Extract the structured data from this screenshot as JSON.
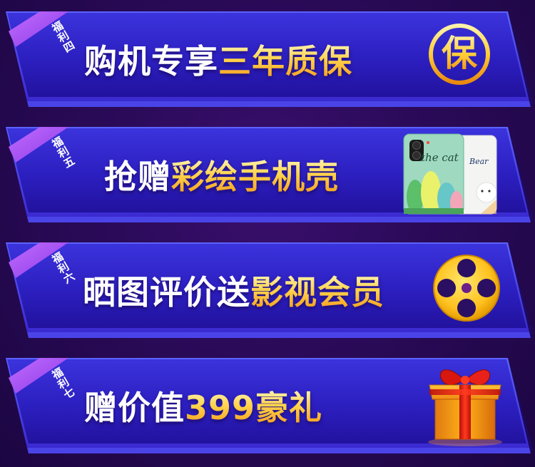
{
  "banners": [
    {
      "tag": "福利四",
      "headline_white": "购机专享",
      "headline_gold": "三年质保",
      "badge_char": "保",
      "icon": "warranty-badge-icon"
    },
    {
      "tag": "福利五",
      "headline_white": "抢赠",
      "headline_gold": "彩绘手机壳",
      "case_left_text": "the cat",
      "case_right_text": "Bear",
      "icon": "phone-case-image"
    },
    {
      "tag": "福利六",
      "headline_white": "晒图评价送",
      "headline_gold": "影视会员",
      "icon": "film-reel-icon"
    },
    {
      "tag": "福利七",
      "headline_white": "赠价值",
      "headline_gold": "399豪礼",
      "icon": "gift-box-icon"
    }
  ],
  "colors": {
    "panel_top": "#3a2fd6",
    "panel_bottom": "#2414a8",
    "ribbon": "#a44ff0",
    "gold": "#ffc83a"
  }
}
